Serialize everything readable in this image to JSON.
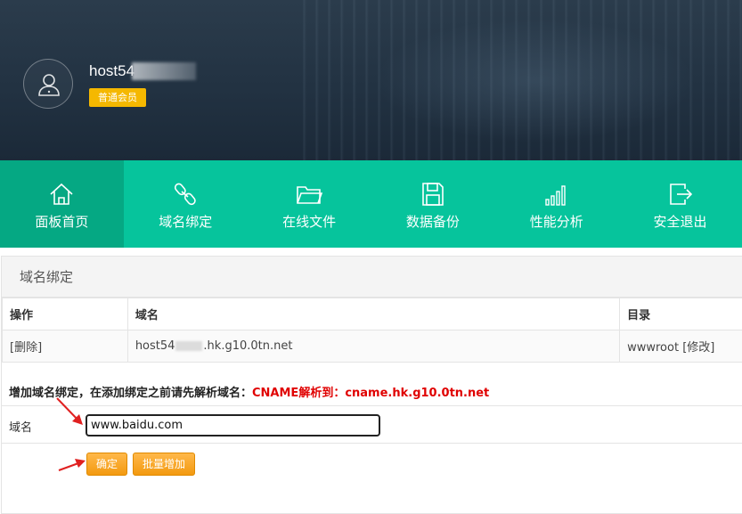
{
  "header": {
    "username": "host54",
    "member_level": "普通会员"
  },
  "nav": {
    "items": [
      {
        "label": "面板首页",
        "icon": "home-icon"
      },
      {
        "label": "域名绑定",
        "icon": "link-icon"
      },
      {
        "label": "在线文件",
        "icon": "folder-icon"
      },
      {
        "label": "数据备份",
        "icon": "save-icon"
      },
      {
        "label": "性能分析",
        "icon": "bar-chart-icon"
      },
      {
        "label": "安全退出",
        "icon": "logout-icon"
      }
    ],
    "active_index": 0
  },
  "panel": {
    "title": "域名绑定",
    "table": {
      "headers": [
        "操作",
        "域名",
        "目录"
      ],
      "rows": [
        {
          "action": "[删除]",
          "domain_prefix": "host54",
          "domain_suffix": ".hk.g10.0tn.net",
          "dir": "wwwroot",
          "dir_action": "[修改]"
        }
      ]
    },
    "add_hint": "增加域名绑定，在添加绑定之前请先解析域名：",
    "add_hint_red": "CNAME解析到：cname.hk.g10.0tn.net",
    "field_label": "域名",
    "domain_value": "www.baidu.com",
    "buttons": {
      "confirm": "确定",
      "batch_add": "批量增加"
    }
  },
  "colors": {
    "nav_bg": "#06c49c",
    "nav_active": "#05a883",
    "badge": "#f5b800",
    "button": "#f39a10",
    "hint_red": "#e00000",
    "arrow_red": "#e02020"
  }
}
